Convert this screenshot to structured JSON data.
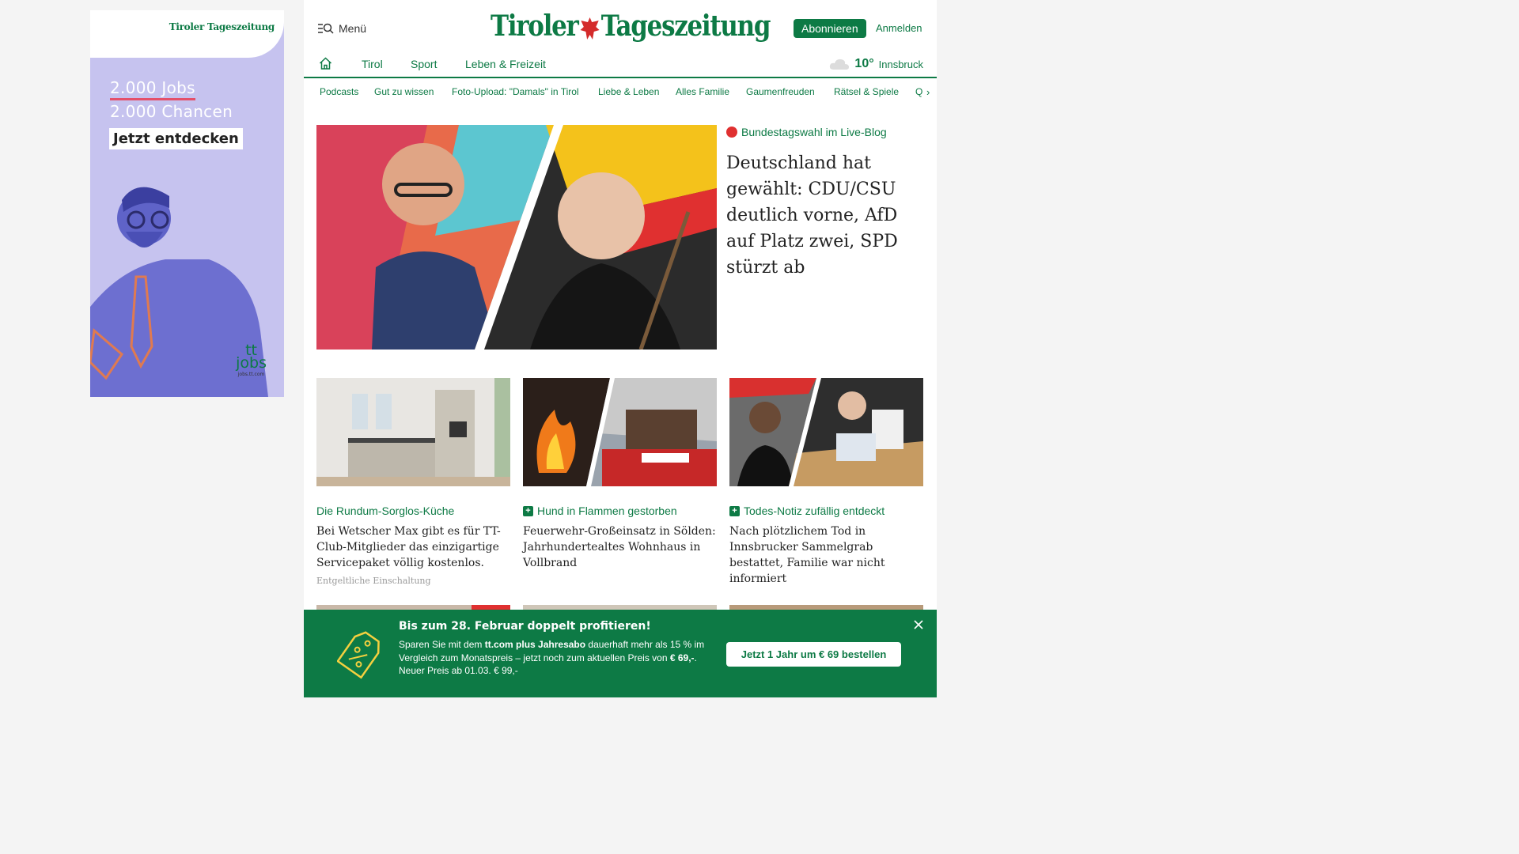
{
  "ad": {
    "logo": "Tiroler Tageszeitung",
    "line1": "2.000 Jobs",
    "line2": "2.000 Chancen",
    "cta": "Jetzt entdecken",
    "brand_top": "tt",
    "brand_bottom": "jobs",
    "brand_url": "jobs.tt.com"
  },
  "header": {
    "menu_label": "Menü",
    "logo_left": "Tiroler",
    "logo_right": "Tageszeitung",
    "subscribe_label": "Abonnieren",
    "login_label": "Anmelden"
  },
  "nav": {
    "items": [
      "Tirol",
      "Sport",
      "Leben & Freizeit"
    ]
  },
  "weather": {
    "temp": "10°",
    "city": "Innsbruck"
  },
  "subnav": {
    "items": [
      "Podcasts",
      "Gut zu wissen",
      "Foto-Upload: \"Damals\" in Tirol",
      "Liebe & Leben",
      "Alles Familie",
      "Gaumenfreuden",
      "Rätsel & Spiele",
      "Q"
    ]
  },
  "hero": {
    "kicker": "Bundestagswahl im Live-Blog",
    "title": "Deutschland hat gewählt: CDU/CSU deutlich vorne, AfD auf Platz zwei, SPD stürzt ab"
  },
  "cards": [
    {
      "kicker": "Die Rundum-Sorglos-Küche",
      "text": "Bei Wetscher Max gibt es für TT-Club-Mitglieder das einzigartige Servicepaket völlig kostenlos.",
      "paid": "Entgeltliche Einschaltung"
    },
    {
      "kicker": "Hund in Flammen gestorben",
      "text": "Feuerwehr-Großeinsatz in Sölden: Jahrhundertealtes Wohnhaus in Vollbrand"
    },
    {
      "kicker": "Todes-Notiz zufällig entdeckt",
      "text": "Nach plötzlichem Tod in Innsbrucker Sammelgrab bestattet, Familie war nicht informiert"
    }
  ],
  "promo": {
    "title": "Bis zum 28. Februar doppelt profitieren!",
    "body_1": "Sparen Sie mit dem ",
    "body_bold1": "tt.com plus Jahresabo",
    "body_2": " dauerhaft mehr als 15 % im Vergleich zum Monatspreis – jetzt noch zum aktuellen Preis von ",
    "body_bold2": "€ 69,-",
    "body_3": ".",
    "body_4": "Neuer Preis ab 01.03. € 99,-",
    "button": "Jetzt 1 Jahr um € 69 bestellen"
  },
  "colors": {
    "brand_green": "#0d7a45",
    "live_red": "#e03030",
    "ad_purple": "#c6c3ef"
  }
}
